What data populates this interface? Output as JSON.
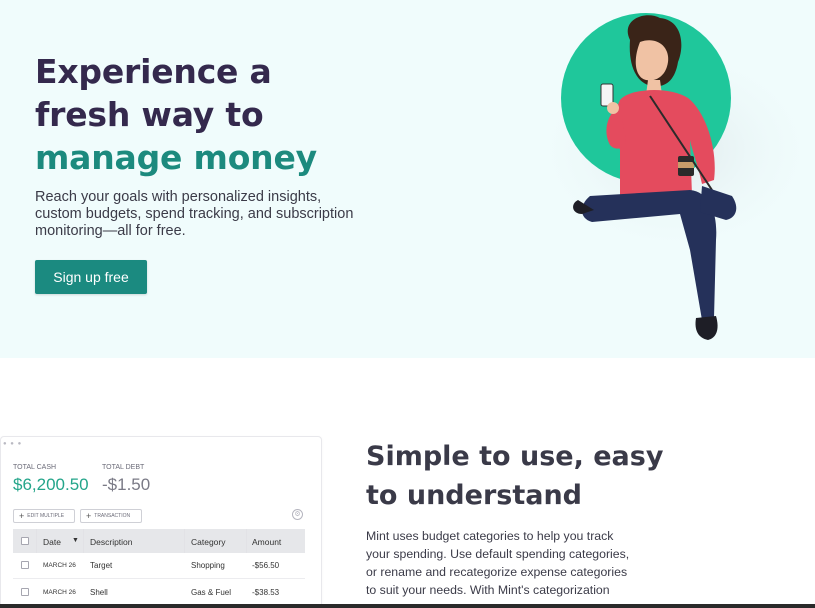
{
  "hero": {
    "title_line1": "Experience a",
    "title_line2": "fresh way to",
    "title_line3": "manage money",
    "subtitle": "Reach your goals with personalized insights, custom budgets, spend tracking, and subscription monitoring—all for free.",
    "cta_label": "Sign up free"
  },
  "dashboard": {
    "total_cash_label": "TOTAL CASH",
    "total_cash_value": "$6,200.50",
    "total_debt_label": "TOTAL DEBT",
    "total_debt_value": "-$1.50",
    "edit_multiple_label": "EDIT MULTIPLE",
    "transaction_label": "TRANSACTION",
    "columns": [
      "Date",
      "Description",
      "Category",
      "Amount"
    ],
    "rows": [
      {
        "date": "MARCH 26",
        "description": "Target",
        "category": "Shopping",
        "amount": "-$56.50"
      },
      {
        "date": "MARCH 26",
        "description": "Shell",
        "category": "Gas & Fuel",
        "amount": "-$38.53"
      }
    ]
  },
  "feature": {
    "title_line1": "Simple to use, easy",
    "title_line2": "to understand",
    "body": "Mint uses budget categories to help you track your spending. Use default spending categories, or rename and recategorize expense categories to suit your needs. With Mint's categorization"
  },
  "colors": {
    "brand_teal": "#1b8a80",
    "title_purple": "#34294d",
    "hero_bg": "#f0fcfc",
    "cash_green": "#24a58a"
  }
}
